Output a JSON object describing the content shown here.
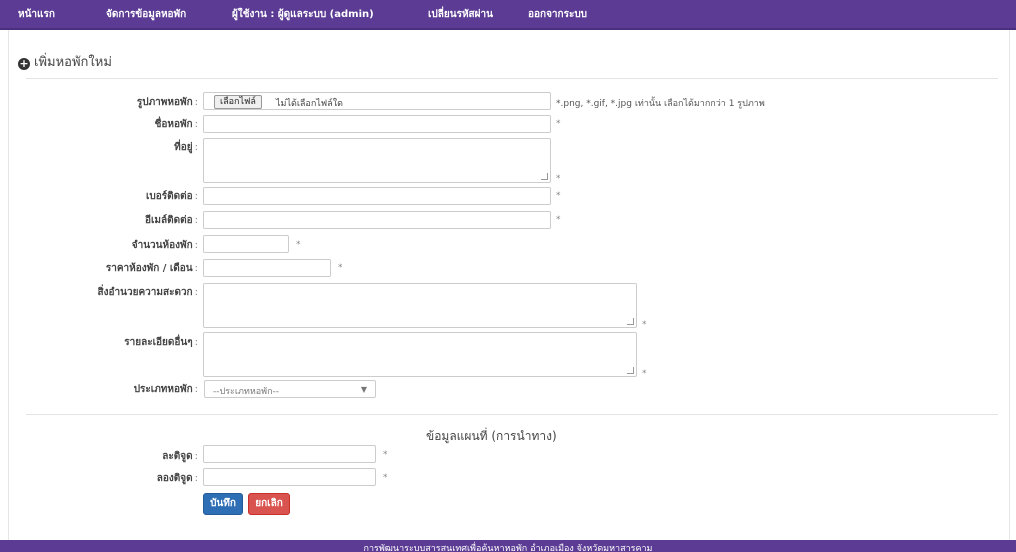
{
  "nav": {
    "items": [
      {
        "label": "หน้าแรก"
      },
      {
        "label": "จัดการข้อมูลหอพัก"
      },
      {
        "label": "ผู้ใช้งาน : ผู้ดูแลระบบ (admin)"
      },
      {
        "label": "เปลี่ยนรหัสผ่าน"
      },
      {
        "label": "ออกจากระบบ"
      }
    ]
  },
  "form": {
    "section_title": "เพิ่มหอพักใหม่",
    "image_label": "รูปภาพหอพัก",
    "file_button": "เลือกไฟล์",
    "file_status": "ไม่ได้เลือกไฟล์ใด",
    "file_hint": "*.png, *.gif, *.jpg เท่านั้น เลือกได้มากกว่า 1 รูปภาพ",
    "name_label": "ชื่อหอพัก",
    "address_label": "ที่อยู่",
    "phone_label": "เบอร์ติดต่อ",
    "email_label": "อีเมล์ติดต่อ",
    "rooms_label": "จำนวนห้องพัก",
    "price_label": "ราคาห้องพัก / เดือน",
    "facilities_label": "สิ่งอำนวยความสะดวก",
    "details_label": "รายละเอียดอื่นๆ",
    "type_label": "ประเภทหอพัก",
    "type_selected": "--ประเภทหอพัก--",
    "colon": ":",
    "required_mark": "*"
  },
  "map": {
    "title": "ข้อมูลแผนที่ (การนำทาง)",
    "lat_label": "ละติจูด",
    "lng_label": "ลองติจูด"
  },
  "buttons": {
    "save": "บันทึก",
    "cancel": "ยกเลิก"
  },
  "footer": {
    "text": "การพัฒนาระบบสารสนเทศเพื่อค้นหาหอพัก อำเภอเมือง จังหวัดมหาสารคาม"
  }
}
